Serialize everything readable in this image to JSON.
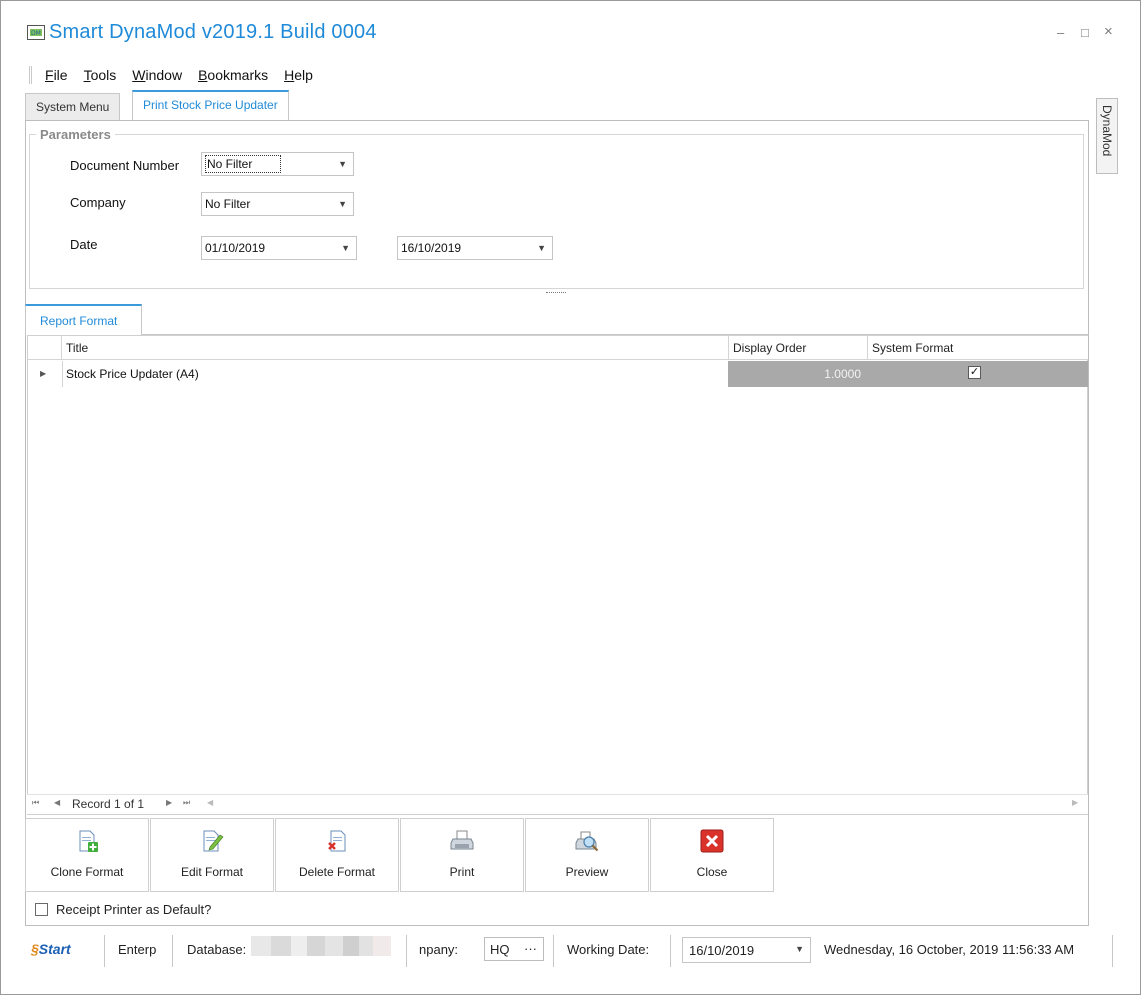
{
  "window": {
    "title": "Smart DynaMod v2019.1 Build 0004",
    "minimize_glyph": "–",
    "maximize_glyph": "□",
    "close_glyph": "×"
  },
  "menu": [
    {
      "accel": "F",
      "rest": "ile"
    },
    {
      "accel": "T",
      "rest": "ools"
    },
    {
      "accel": "W",
      "rest": "indow"
    },
    {
      "accel": "B",
      "rest": "ookmarks"
    },
    {
      "accel": "H",
      "rest": "elp"
    }
  ],
  "tabs": {
    "system_menu": "System Menu",
    "print_stock": "Print Stock Price Updater"
  },
  "side_tab": "DynaMod",
  "parameters": {
    "legend": "Parameters",
    "document_number_label": "Document Number",
    "document_number_value": "No Filter",
    "company_label": "Company",
    "company_value": "No Filter",
    "date_label": "Date",
    "date_from": "01/10/2019",
    "date_to": "16/10/2019"
  },
  "report_format": {
    "tab": "Report Format",
    "columns": {
      "title": "Title",
      "display_order": "Display Order",
      "system_format": "System Format"
    },
    "rows": [
      {
        "title": "Stock Price Updater (A4)",
        "display_order": "1.0000",
        "system_format": true,
        "check_glyph": "✓"
      }
    ],
    "navigator": "Record 1 of 1"
  },
  "buttons": {
    "clone": "Clone Format",
    "edit": "Edit Format",
    "delete": "Delete Format",
    "print": "Print",
    "preview": "Preview",
    "close": "Close"
  },
  "receipt_printer_label": "Receipt Printer as Default?",
  "status": {
    "start": "Start",
    "enterprise": "Enterp",
    "database_label": "Database:",
    "company_label": "npany:",
    "company_value": "HQ",
    "company_more": "···",
    "working_date_label": "Working Date:",
    "working_date": "16/10/2019",
    "datetime": "Wednesday, 16 October, 2019 11:56:33 AM"
  },
  "colors": {
    "accent": "#1f8ad8",
    "selected_row": "#a9a9a9",
    "close_icon_red": "#d9322b"
  }
}
